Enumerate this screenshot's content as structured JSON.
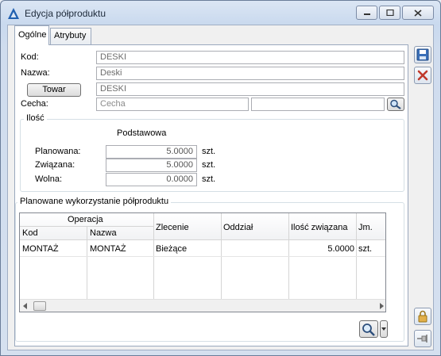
{
  "window": {
    "title": "Edycja półproduktu"
  },
  "tabs": [
    {
      "label": "Ogólne"
    },
    {
      "label": "Atrybuty"
    }
  ],
  "form": {
    "kod_label": "Kod:",
    "kod_value": "DESKI",
    "nazwa_label": "Nazwa:",
    "nazwa_value": "Deski",
    "towar_button": "Towar",
    "towar_value": "DESKI",
    "cecha_label": "Cecha:",
    "cecha_placeholder": "Cecha",
    "cecha_value2": ""
  },
  "ilosc": {
    "group_title": "Ilość",
    "column_header": "Podstawowa",
    "rows": [
      {
        "label": "Planowana:",
        "value": "5.0000",
        "unit": "szt."
      },
      {
        "label": "Związana:",
        "value": "5.0000",
        "unit": "szt."
      },
      {
        "label": "Wolna:",
        "value": "0.0000",
        "unit": "szt."
      }
    ]
  },
  "usage": {
    "group_title": "Planowane wykorzystanie półproduktu",
    "header": {
      "operacja": "Operacja",
      "kod": "Kod",
      "nazwa": "Nazwa",
      "zlecenie": "Zlecenie",
      "oddzial": "Oddział",
      "ilosc": "Ilość związana",
      "jm": "Jm."
    },
    "rows": [
      {
        "kod": "MONTAŻ",
        "nazwa": "MONTAŻ",
        "zlecenie": "Bieżące",
        "oddzial": "",
        "ilosc": "5.0000",
        "jm": "szt."
      }
    ]
  },
  "colors": {
    "accent": "#2b6cb0",
    "close_red": "#c0392b"
  }
}
